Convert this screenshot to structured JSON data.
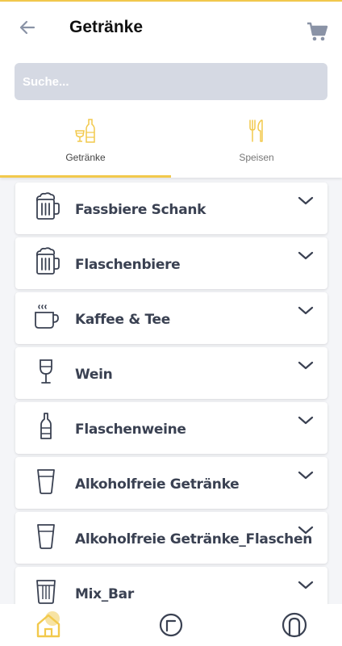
{
  "header": {
    "title": "Getränke",
    "back_icon": "arrow-left-icon",
    "cart_icon": "cart-icon"
  },
  "search": {
    "placeholder": "Suche..."
  },
  "tabs": [
    {
      "label": "Getränke",
      "icon": "drinks-icon",
      "active": true
    },
    {
      "label": "Speisen",
      "icon": "cutlery-icon",
      "active": false
    }
  ],
  "categories": [
    {
      "label": "Fassbiere Schank",
      "icon": "beer-mug-icon"
    },
    {
      "label": "Flaschenbiere",
      "icon": "beer-mug-icon"
    },
    {
      "label": "Kaffee & Tee",
      "icon": "coffee-cup-icon"
    },
    {
      "label": "Wein",
      "icon": "wine-glass-icon"
    },
    {
      "label": "Flaschenweine",
      "icon": "wine-bottle-icon"
    },
    {
      "label": "Alkoholfreie Getränke",
      "icon": "glass-icon"
    },
    {
      "label": "Alkoholfreie Getränke_Flaschen",
      "icon": "glass-icon"
    },
    {
      "label": "Mix_Bar",
      "icon": "tumbler-icon"
    }
  ],
  "bottom_nav": [
    {
      "icon": "home-icon",
      "active": true
    },
    {
      "icon": "orders-icon",
      "active": false
    },
    {
      "icon": "profile-icon",
      "active": false
    }
  ],
  "colors": {
    "accent": "#f2c94c",
    "text": "#3a4152",
    "icon": "#3a4152",
    "search_bg": "#d5d9e3"
  }
}
